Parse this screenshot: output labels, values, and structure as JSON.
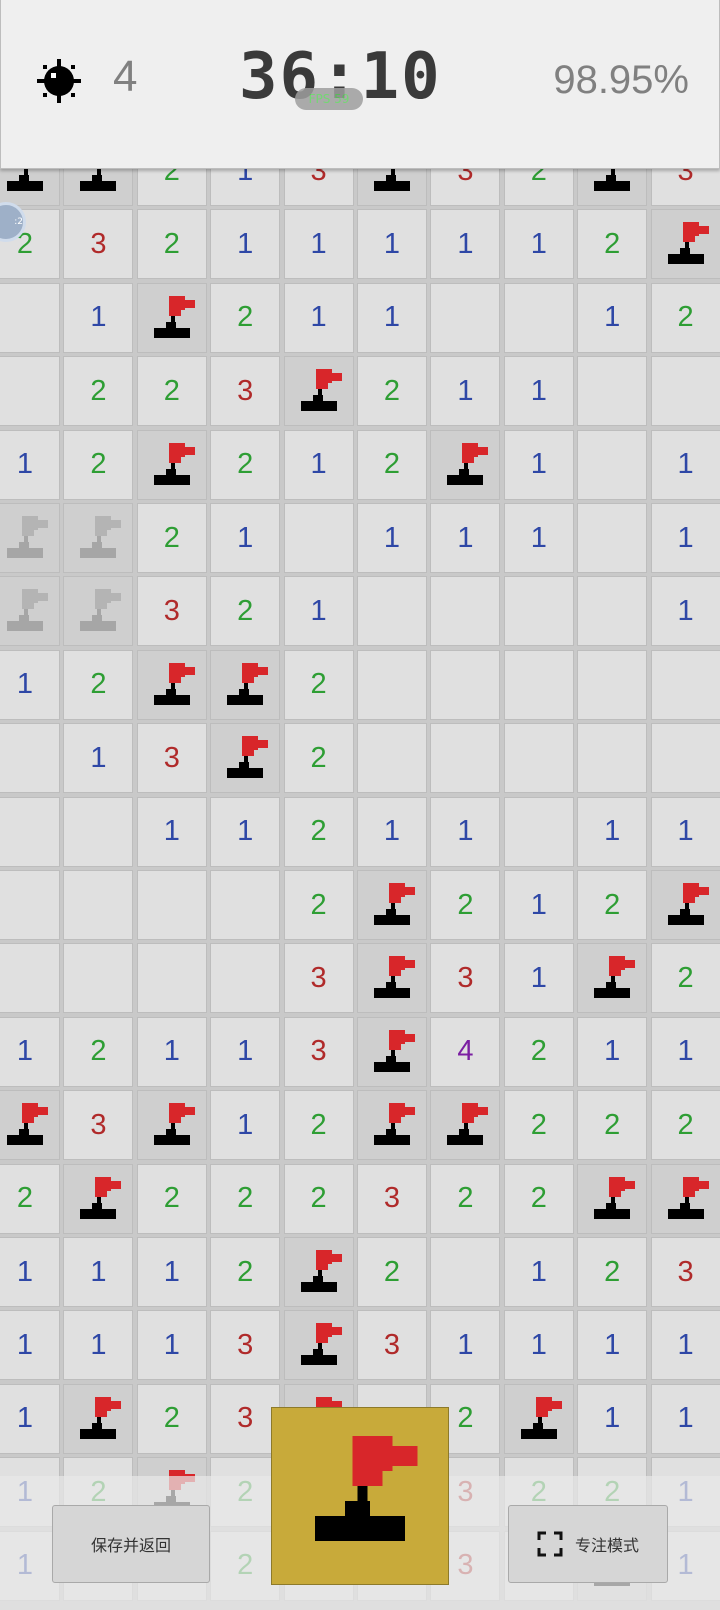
{
  "header": {
    "mine_icon": "mine-icon",
    "mines_left": "4",
    "timer": "36:10",
    "fps_badge": "FPS 59",
    "progress": "98.95%"
  },
  "board": {
    "colors": {
      "1": "#2e47a6",
      "2": "#2e9e34",
      "3": "#b02a2a",
      "4": "#7b1fa2"
    },
    "rows": [
      [
        "F",
        "F",
        "2",
        "1",
        "3",
        "F",
        "3",
        "2",
        "F",
        "3"
      ],
      [
        "2",
        "3",
        "2",
        "1",
        "1",
        "1",
        "1",
        "1",
        "2",
        "F"
      ],
      [
        "",
        "1",
        "F",
        "2",
        "1",
        "1",
        "",
        "",
        "1",
        "2"
      ],
      [
        "",
        "2",
        "2",
        "3",
        "F",
        "2",
        "1",
        "1",
        "",
        ""
      ],
      [
        "1",
        "2",
        "F",
        "2",
        "1",
        "2",
        "F",
        "1",
        "",
        "1"
      ],
      [
        "G",
        "G",
        "2",
        "1",
        "",
        "1",
        "1",
        "1",
        "",
        "1"
      ],
      [
        "G",
        "G",
        "3",
        "2",
        "1",
        "",
        "",
        "",
        "",
        "1"
      ],
      [
        "1",
        "2",
        "F",
        "F",
        "2",
        "",
        "",
        "",
        "",
        ""
      ],
      [
        "",
        "1",
        "3",
        "F",
        "2",
        "",
        "",
        "",
        "",
        ""
      ],
      [
        "",
        "",
        "1",
        "1",
        "2",
        "1",
        "1",
        "",
        "1",
        "1"
      ],
      [
        "",
        "",
        "",
        "",
        "2",
        "F",
        "2",
        "1",
        "2",
        "F"
      ],
      [
        "",
        "",
        "",
        "",
        "3",
        "F",
        "3",
        "1",
        "F",
        "2"
      ],
      [
        "1",
        "2",
        "1",
        "1",
        "3",
        "F",
        "4",
        "2",
        "1",
        "1"
      ],
      [
        "F",
        "3",
        "F",
        "1",
        "2",
        "F",
        "F",
        "2",
        "2",
        "2"
      ],
      [
        "2",
        "F",
        "2",
        "2",
        "2",
        "3",
        "2",
        "2",
        "F",
        "F"
      ],
      [
        "1",
        "1",
        "1",
        "2",
        "F",
        "2",
        "",
        "1",
        "2",
        "3"
      ],
      [
        "1",
        "1",
        "1",
        "3",
        "F",
        "3",
        "1",
        "1",
        "1",
        "1"
      ],
      [
        "1",
        "F",
        "2",
        "3",
        "F",
        "",
        "2",
        "F",
        "1",
        "1"
      ],
      [
        "1",
        "2",
        "F",
        "2",
        "",
        "",
        "3",
        "2",
        "2",
        "1"
      ],
      [
        "1",
        "",
        "",
        "2",
        "",
        "",
        "3",
        "",
        "F",
        "1"
      ]
    ]
  },
  "buttons": {
    "save_label": "保存并返回",
    "focus_label": "专注模式",
    "focus_icon": "fullscreen-icon",
    "flag_toggle_icon": "flag-icon"
  }
}
